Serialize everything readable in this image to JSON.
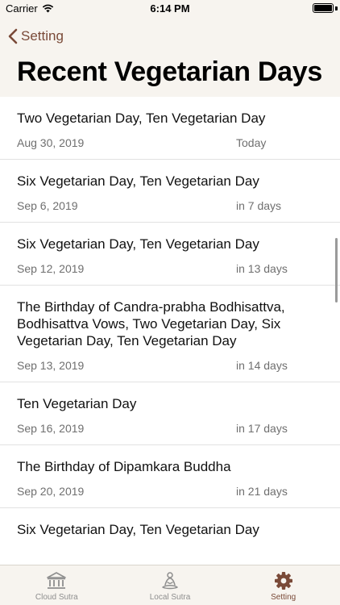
{
  "status_bar": {
    "carrier": "Carrier",
    "time": "6:14 PM"
  },
  "header": {
    "back_label": "Setting",
    "title": "Recent Vegetarian Days"
  },
  "items": [
    {
      "title": "Two Vegetarian Day, Ten Vegetarian Day",
      "date": "Aug 30, 2019",
      "relative": "Today"
    },
    {
      "title": "Six Vegetarian Day, Ten Vegetarian Day",
      "date": "Sep 6, 2019",
      "relative": "in 7 days"
    },
    {
      "title": "Six Vegetarian Day, Ten Vegetarian Day",
      "date": "Sep 12, 2019",
      "relative": "in 13 days"
    },
    {
      "title": "The Birthday of Candra-prabha Bodhisattva, Bodhisattva Vows, Two Vegetarian Day, Six Vegetarian Day, Ten Vegetarian Day",
      "date": "Sep 13, 2019",
      "relative": "in 14 days"
    },
    {
      "title": "Ten Vegetarian Day",
      "date": "Sep 16, 2019",
      "relative": "in 17 days"
    },
    {
      "title": "The Birthday of Dipamkara Buddha",
      "date": "Sep 20, 2019",
      "relative": "in 21 days"
    },
    {
      "title": "Six Vegetarian Day, Ten Vegetarian Day",
      "date": "",
      "relative": ""
    }
  ],
  "tab_bar": {
    "tabs": [
      {
        "label": "Cloud Sutra",
        "icon": "bank-icon"
      },
      {
        "label": "Local Sutra",
        "icon": "meditation-icon"
      },
      {
        "label": "Setting",
        "icon": "gear-icon"
      }
    ],
    "active": "Setting"
  },
  "colors": {
    "accent": "#7a4a38",
    "bar_background": "#f7f4ef",
    "inactive": "#8e8e8e"
  }
}
